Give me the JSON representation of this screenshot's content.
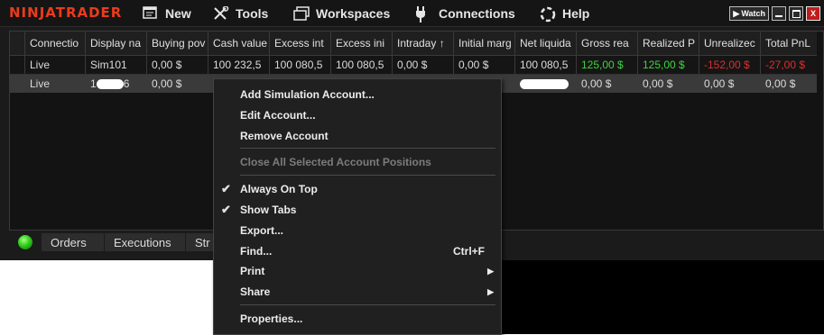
{
  "app": {
    "logo": "NINJATRADER",
    "menu": [
      {
        "label": "New",
        "icon": "new-window-icon"
      },
      {
        "label": "Tools",
        "icon": "tools-icon"
      },
      {
        "label": "Workspaces",
        "icon": "workspaces-icon"
      },
      {
        "label": "Connections",
        "icon": "plug-icon"
      },
      {
        "label": "Help",
        "icon": "help-icon"
      }
    ],
    "window_buttons": {
      "watch": "Watch",
      "minimize": "",
      "maximize": "",
      "close": "X"
    }
  },
  "grid": {
    "columns": [
      "Connectio",
      "Display na",
      "Buying pov",
      "Cash value",
      "Excess int",
      "Excess ini",
      "Intraday ↑",
      "Initial marg",
      "Net liquida",
      "Gross rea",
      "Realized P",
      "Unrealizec",
      "Total PnL"
    ],
    "rows": [
      [
        "Live",
        "Sim101",
        "0,00 $",
        "100 232,5",
        "100 080,5",
        "100 080,5",
        "0,00 $",
        "0,00 $",
        "100 080,5",
        "125,00 $",
        "125,00 $",
        "-152,00 $",
        "-27,00 $"
      ],
      [
        "Live",
        "1",
        "0,00 $",
        "",
        "",
        "",
        "",
        "",
        "",
        "0,00 $",
        "0,00 $",
        "0,00 $",
        "0,00 $"
      ]
    ],
    "row2_display_suffix": "6"
  },
  "statusbar": {
    "tabs": [
      "Orders",
      "Executions",
      "Str"
    ]
  },
  "context_menu": {
    "items": [
      {
        "label": "Add Simulation Account..."
      },
      {
        "label": "Edit Account..."
      },
      {
        "label": "Remove Account"
      },
      {
        "label": "Close All Selected Account Positions",
        "disabled": true
      },
      {
        "label": "Always On Top",
        "checked": true
      },
      {
        "label": "Show Tabs",
        "checked": true
      },
      {
        "label": "Export..."
      },
      {
        "label": "Find...",
        "shortcut": "Ctrl+F"
      },
      {
        "label": "Print",
        "submenu": true
      },
      {
        "label": "Share",
        "submenu": true
      },
      {
        "label": "Properties..."
      }
    ]
  },
  "colors": {
    "logo": "#ea3b1d",
    "positive": "#3ed33e",
    "negative": "#e02d2d",
    "background": "#1b1b1b"
  }
}
